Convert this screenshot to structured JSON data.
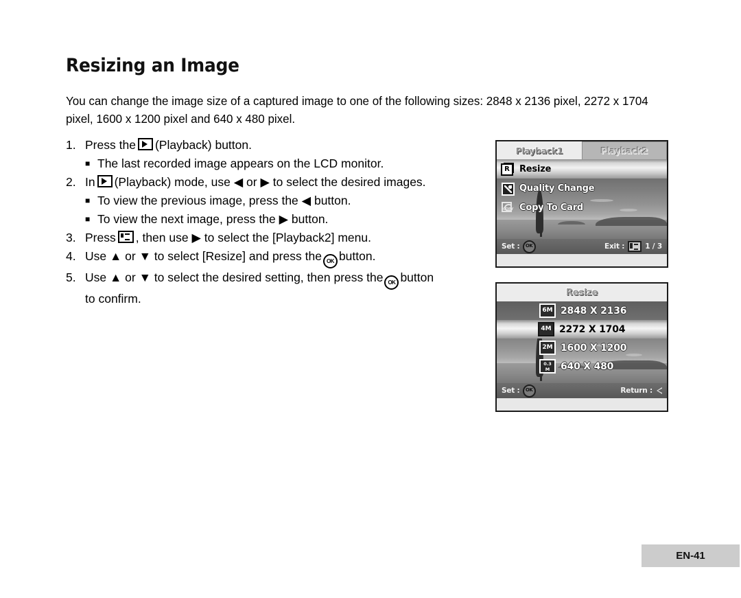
{
  "page": {
    "title": "Resizing an Image",
    "intro": "You can change the image size of a captured image to one of the following sizes: 2848 x 2136 pixel, 2272 x 1704 pixel, 1600 x 1200 pixel and 640 x 480 pixel.",
    "footer_label": "EN-41"
  },
  "steps": [
    {
      "num": "1.",
      "pre": "Press the",
      "icon": "playback-icon",
      "post": "(Playback) button.",
      "subs": [
        {
          "bullet": "■",
          "text": "The last recorded image appears on the LCD monitor."
        }
      ]
    },
    {
      "num": "2.",
      "pre": "In",
      "icon": "playback-icon",
      "post": "(Playback) mode, use ◀ or ▶ to select the desired images.",
      "subs": [
        {
          "bullet": "■",
          "text": "To view the previous image, press the ◀ button."
        },
        {
          "bullet": "■",
          "text": "To view the next image, press the ▶ button."
        }
      ]
    },
    {
      "num": "3.",
      "pre": "Press",
      "icon": "menu-icon",
      "post": ", then use ▶ to select the [Playback2] menu.",
      "subs": []
    },
    {
      "num": "4.",
      "pre": "Use ▲ or ▼ to select [Resize] and press the",
      "icon": "ok-icon",
      "post": "button.",
      "subs": []
    },
    {
      "num": "5.",
      "pre": "Use ▲ or ▼ to select the desired setting, then press the",
      "icon": "ok-icon",
      "post": "button",
      "continuation": "to confirm.",
      "subs": []
    }
  ],
  "lcd_menu": {
    "tabs": [
      {
        "label": "Playback1",
        "active": true
      },
      {
        "label": "Playback2",
        "active": false
      }
    ],
    "items": [
      {
        "label": "Resize",
        "icon": "resize-icon",
        "selected": true
      },
      {
        "label": "Quality Change",
        "icon": "quality-change-icon",
        "selected": false
      },
      {
        "label": "Copy To Card",
        "icon": "copy-to-card-icon",
        "selected": false
      }
    ],
    "status": {
      "set_label": "Set :",
      "set_icon": "ok-icon",
      "exit_label": "Exit :",
      "exit_icon": "menu-icon",
      "page_indicator": "1 / 3"
    }
  },
  "lcd_resize": {
    "title": "Resize",
    "options": [
      {
        "badge": "6M",
        "badge_top": "",
        "badge_bottom": "",
        "label": "2848 X 2136",
        "selected": false
      },
      {
        "badge": "4M",
        "badge_top": "",
        "badge_bottom": "",
        "label": "2272 X 1704",
        "selected": true
      },
      {
        "badge": "2M",
        "badge_top": "",
        "badge_bottom": "",
        "label": "1600  X 1200",
        "selected": false
      },
      {
        "badge": "",
        "badge_top": "0.3",
        "badge_bottom": "M",
        "label": "640 X 480",
        "selected": false
      }
    ],
    "status": {
      "set_label": "Set :",
      "set_icon": "ok-icon",
      "return_label": "Return :",
      "return_icon": "left-triangle-icon"
    }
  },
  "colors": {
    "footer_bg": "#cccccc",
    "lcd_border": "#1a1a1a",
    "selected_row": "#f2f2f2"
  }
}
